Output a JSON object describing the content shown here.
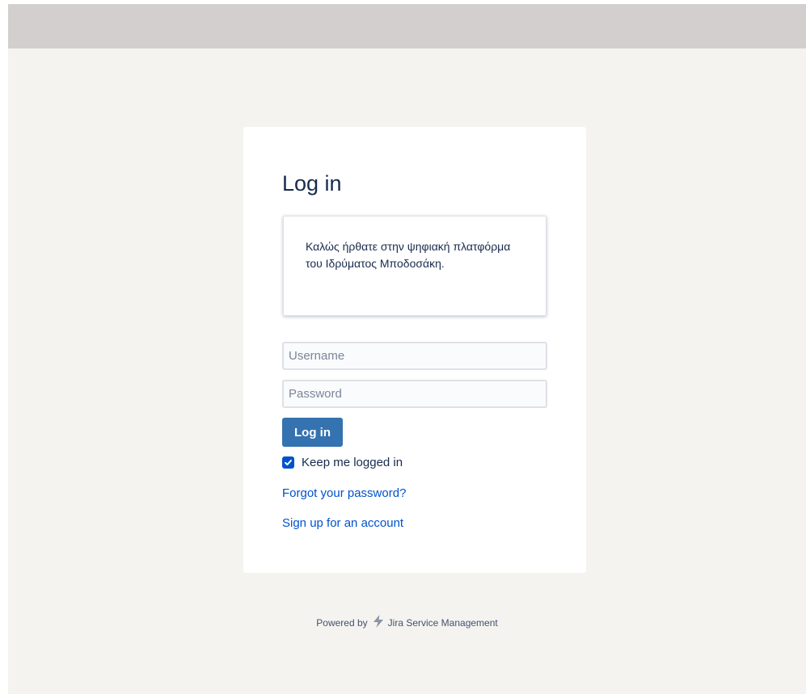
{
  "login": {
    "title": "Log in",
    "welcome_message": "Καλώς ήρθατε στην ψηφιακή πλατφόρμα του Ιδρύματος Μποδοσάκη.",
    "username_placeholder": "Username",
    "password_placeholder": "Password",
    "submit_label": "Log in",
    "remember_label": "Keep me logged in",
    "remember_checked": true,
    "forgot_password_link": "Forgot your password?",
    "signup_link": "Sign up for an account"
  },
  "footer": {
    "powered_by": "Powered by",
    "product": "Jira Service Management",
    "logo_icon": "jira-service-management-icon"
  },
  "colors": {
    "primary_button": "#3572b0",
    "link": "#0052cc",
    "header_bar": "#d3cfce",
    "page_background": "#f4f3f0"
  }
}
